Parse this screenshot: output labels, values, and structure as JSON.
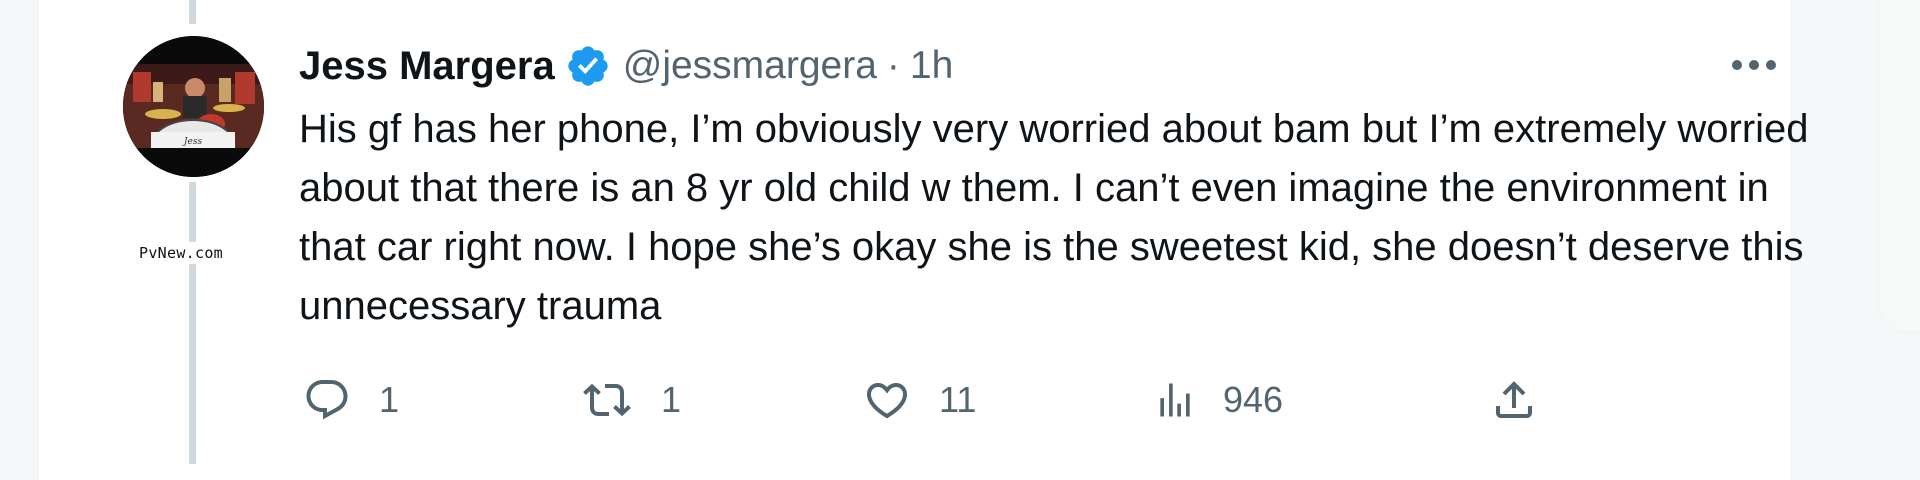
{
  "tweet": {
    "author": {
      "display_name": "Jess Margera",
      "handle": "@jessmargera",
      "verified": true,
      "avatar_icon": "drummer-avatar"
    },
    "separator": "·",
    "time": "1h",
    "body": "His gf has her phone, I’m obviously very worried about bam but I’m extremely worried about that there is an 8 yr old child w them. I can’t even imagine the environment in that car right now. I hope she’s okay she is the sweetest kid, she doesn’t deserve this unnecessary trauma",
    "actions": {
      "reply": {
        "icon": "reply-icon",
        "count": "1"
      },
      "retweet": {
        "icon": "retweet-icon",
        "count": "1"
      },
      "like": {
        "icon": "heart-icon",
        "count": "11"
      },
      "views": {
        "icon": "views-icon",
        "count": "946"
      },
      "share": {
        "icon": "share-icon"
      }
    }
  },
  "watermark": "PvNew.com",
  "colors": {
    "verified_blue": "#1d9bf0",
    "text_primary": "#0f1419",
    "text_secondary": "#536471",
    "thread_line": "#cfd9de"
  }
}
